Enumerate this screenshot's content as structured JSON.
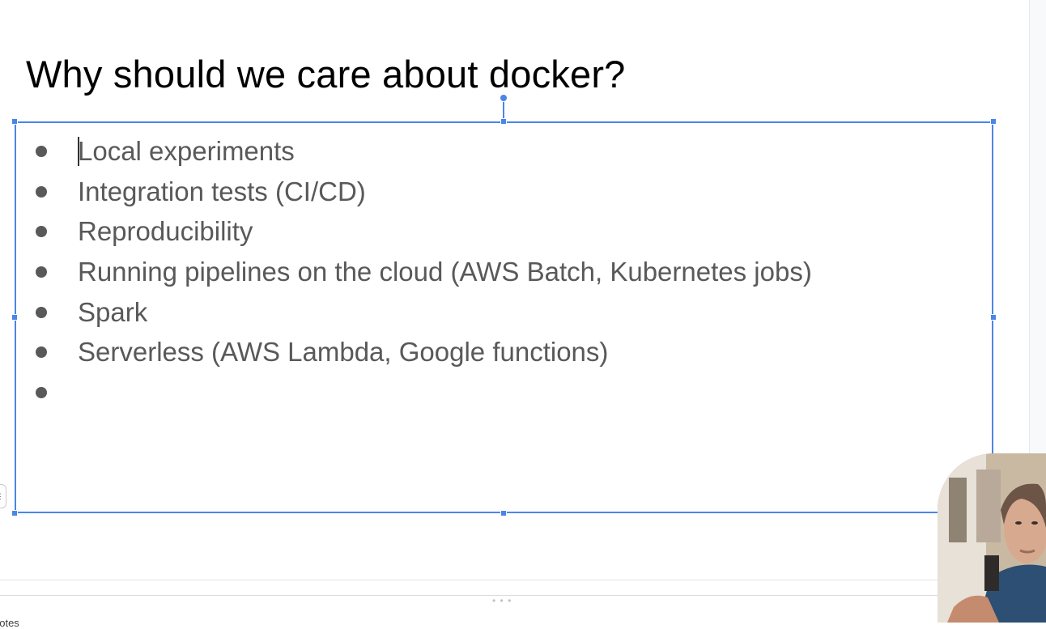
{
  "slide": {
    "title": "Why should we care about docker?",
    "bullets": [
      "Local experiments",
      "Integration tests (CI/CD)",
      "Reproducibility",
      "Running pipelines on the cloud (AWS Batch, Kubernetes jobs)",
      "Spark",
      "Serverless (AWS Lambda, Google functions)",
      ""
    ]
  },
  "notes": {
    "label": "notes"
  },
  "icons": {
    "rotate_handle": "rotate-handle-icon",
    "bullet": "bullet-dot-icon",
    "side_panel": "side-panel-toggle-icon",
    "drag": "drag-grip-icon"
  },
  "colors": {
    "selection": "#4a86e8",
    "title_text": "#000000",
    "body_text": "#595959"
  }
}
